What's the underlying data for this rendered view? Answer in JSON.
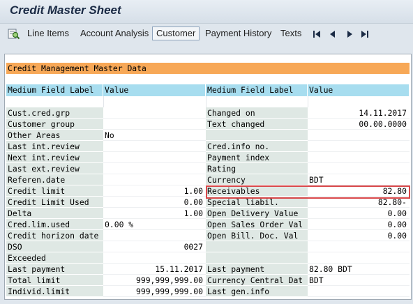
{
  "window": {
    "title": "Credit Master Sheet"
  },
  "toolbar": {
    "line_items": "Line Items",
    "account_analysis": "Account Analysis",
    "customer": "Customer",
    "payment_history": "Payment History",
    "texts": "Texts"
  },
  "section": {
    "title": "Credit Management Master Data"
  },
  "table": {
    "col_label": "Medium Field Label",
    "col_value": "Value",
    "left": [
      {
        "label": "Cust.cred.grp",
        "value": ""
      },
      {
        "label": "Customer group",
        "value": ""
      },
      {
        "label": "Other Areas",
        "value": "No"
      },
      {
        "label": "Last int.review",
        "value": ""
      },
      {
        "label": "Next int.review",
        "value": ""
      },
      {
        "label": "Last ext.review",
        "value": ""
      },
      {
        "label": "Referen.date",
        "value": ""
      },
      {
        "label": "Credit limit",
        "value": "1.00"
      },
      {
        "label": "Credit Limit Used",
        "value": "0.00"
      },
      {
        "label": "Delta",
        "value": "1.00"
      },
      {
        "label": "Cred.lim.used",
        "value": "0.00 %"
      },
      {
        "label": "Credit horizon date",
        "value": ""
      },
      {
        "label": "DSO",
        "value": "0027"
      },
      {
        "label": "Exceeded",
        "value": ""
      },
      {
        "label": "Last payment",
        "value": "15.11.2017"
      },
      {
        "label": "Total limit",
        "value": "999,999,999.00"
      },
      {
        "label": "Individ.limit",
        "value": "999,999,999.00"
      }
    ],
    "right": [
      {
        "label": "Changed on",
        "value": "14.11.2017"
      },
      {
        "label": "Text changed",
        "value": "00.00.0000"
      },
      {
        "label": "",
        "value": ""
      },
      {
        "label": "Cred.info no.",
        "value": ""
      },
      {
        "label": "Payment index",
        "value": ""
      },
      {
        "label": "Rating",
        "value": ""
      },
      {
        "label": "Currency",
        "value": "BDT"
      },
      {
        "label": "Receivables",
        "value": "82.80"
      },
      {
        "label": "Special liabil.",
        "value": "82.80-"
      },
      {
        "label": "Open Delivery Value",
        "value": "0.00"
      },
      {
        "label": "Open Sales Order Val",
        "value": "0.00"
      },
      {
        "label": "Open Bill. Doc. Val",
        "value": "0.00"
      },
      {
        "label": "",
        "value": ""
      },
      {
        "label": "",
        "value": ""
      },
      {
        "label": "Last payment",
        "value": "82.80 BDT"
      },
      {
        "label": "Currency Central Dat",
        "value": "BDT"
      },
      {
        "label": "Last gen.info",
        "value": ""
      }
    ]
  },
  "colors": {
    "banner": "#f7a857",
    "header": "#a7ddef",
    "highlight": "#d9484a"
  }
}
